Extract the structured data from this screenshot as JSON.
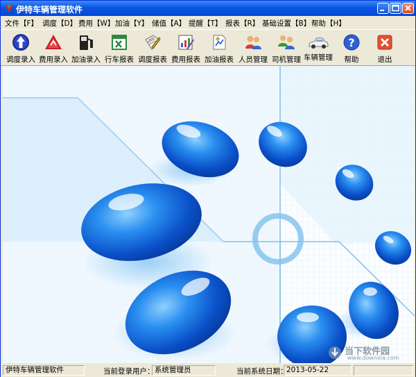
{
  "window": {
    "title": "伊特车辆管理软件"
  },
  "menu": [
    {
      "label": "文件【F】"
    },
    {
      "label": "调度【D】"
    },
    {
      "label": "费用【W】"
    },
    {
      "label": "加油【Y】"
    },
    {
      "label": "储值【A】"
    },
    {
      "label": "提醒【T】"
    },
    {
      "label": "报表【R】"
    },
    {
      "label": "基础设置【B】"
    },
    {
      "label": "帮助【H】"
    }
  ],
  "toolbar": [
    {
      "label": "调度录入",
      "icon": "up-arrow-icon"
    },
    {
      "label": "费用录入",
      "icon": "warning-triangle-icon"
    },
    {
      "label": "加油录入",
      "icon": "fuel-pump-icon"
    },
    {
      "label": "行车报表",
      "icon": "excel-icon"
    },
    {
      "label": "调度报表",
      "icon": "document-pen-icon"
    },
    {
      "label": "费用报表",
      "icon": "chart-pen-icon"
    },
    {
      "label": "加油报表",
      "icon": "fuel-report-icon"
    },
    {
      "label": "人员管理",
      "icon": "people-icon"
    },
    {
      "label": "司机管理",
      "icon": "driver-icon"
    },
    {
      "label": "车辆管理",
      "icon": "car-icon"
    },
    {
      "label": "帮助",
      "icon": "help-icon"
    },
    {
      "label": "退出",
      "icon": "exit-icon"
    }
  ],
  "status": {
    "app_name": "伊特车辆管理软件",
    "user_label": "当前登录用户：",
    "user_value": "系统管理员",
    "date_label": "当前系统日期：",
    "date_value": "2013-05-22"
  },
  "watermark": {
    "text": "当下软件园",
    "sub": "www.downxia.com"
  },
  "colors": {
    "title_bar": "#0a55e2",
    "chrome": "#ece9d8",
    "drop_blue": "#1e73e6"
  }
}
